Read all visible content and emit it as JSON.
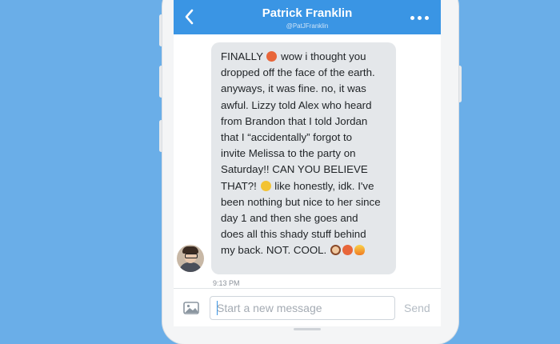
{
  "header": {
    "title": "Patrick Franklin",
    "handle": "@PatJFranklin",
    "back_icon": "chevron-left-icon",
    "more_icon": "more-dots-icon"
  },
  "conversation": {
    "message": {
      "lines": [
        "FINALLY",
        "wow i thought you",
        "dropped off the face of the earth.",
        "anyways, it was fine. no, it was",
        "awful. Lizzy told Alex who heard",
        "from Brandon that I told Jordan",
        "that I “accidentally” forgot to",
        "invite Melissa to the party on",
        "Saturday!! CAN YOU BELIEVE",
        "THAT?!",
        "like honestly, idk. I've",
        "been nothing but nice to her since",
        "day 1 and then she goes and",
        "does all this shady stuff behind",
        "my back. NOT. COOL."
      ],
      "time": "9:13 PM"
    }
  },
  "composer": {
    "placeholder": "Start a new message",
    "value": "",
    "send_label": "Send",
    "image_icon": "image-icon"
  },
  "colors": {
    "background": "#6aaee8",
    "header": "#3a95e4",
    "bubble": "#e4e7ea"
  }
}
